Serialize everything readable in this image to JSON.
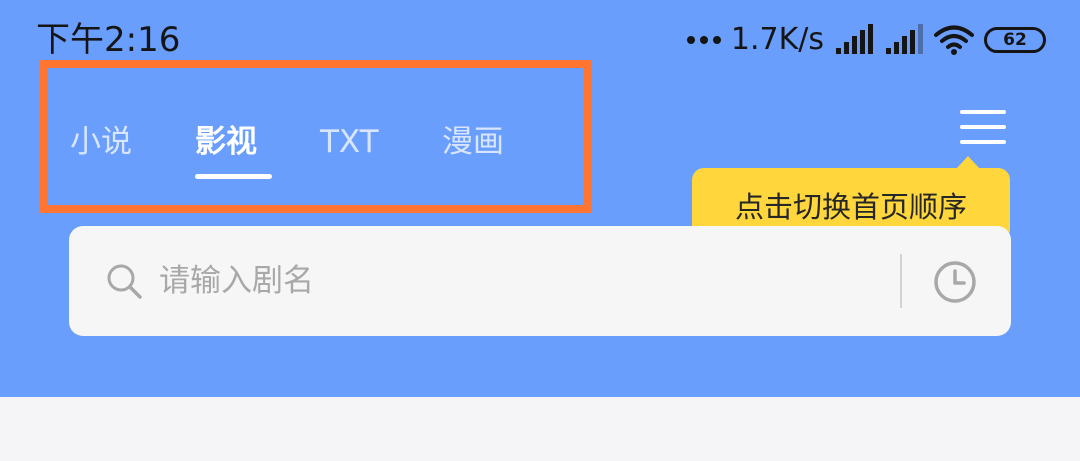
{
  "status_bar": {
    "time": "下午2:16",
    "net_speed": "1.7K/s",
    "battery": "62",
    "icons": [
      "signal-icon",
      "signal-icon",
      "wifi-icon",
      "battery-icon"
    ]
  },
  "tabs": [
    {
      "label": "小说",
      "active": false
    },
    {
      "label": "影视",
      "active": true
    },
    {
      "label": "TXT",
      "active": false
    },
    {
      "label": "漫画",
      "active": false
    }
  ],
  "menu": {
    "icon": "menu-icon"
  },
  "tooltip": {
    "text": "点击切换首页顺序"
  },
  "search": {
    "placeholder": "请输入剧名",
    "value": "",
    "search_icon": "search-icon",
    "history_icon": "clock-icon"
  },
  "colors": {
    "header_bg": "#6a9efc",
    "highlight_border": "#ff7531",
    "tooltip_bg": "#ffd73c",
    "search_bg": "#f6f6f6",
    "page_bg": "#f5f5f7"
  }
}
